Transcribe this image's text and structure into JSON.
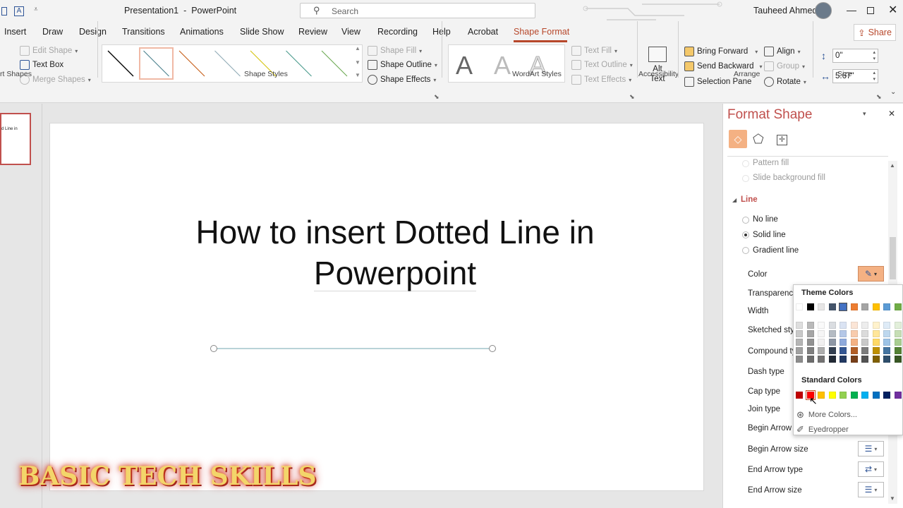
{
  "window": {
    "title": "Presentation1  -  PowerPoint",
    "search_placeholder": "Search",
    "user": "Tauheed Ahmed"
  },
  "tabs": [
    "Insert",
    "Draw",
    "Design",
    "Transitions",
    "Animations",
    "Slide Show",
    "Review",
    "View",
    "Recording",
    "Help",
    "Acrobat",
    "Shape Format"
  ],
  "share_label": "Share",
  "ribbon": {
    "insert_shapes": {
      "label": "rt Shapes",
      "edit_shape": "Edit Shape",
      "text_box": "Text Box",
      "merge_shapes": "Merge Shapes"
    },
    "shape_styles": {
      "label": "Shape Styles",
      "shape_fill": "Shape Fill",
      "shape_outline": "Shape Outline",
      "shape_effects": "Shape Effects"
    },
    "wordart": {
      "label": "WordArt Styles",
      "letter": "A",
      "text_fill": "Text Fill",
      "text_outline": "Text Outline",
      "text_effects": "Text Effects"
    },
    "accessibility": {
      "label": "Accessibility",
      "alt_text_1": "Alt",
      "alt_text_2": "Text"
    },
    "arrange": {
      "label": "Arrange",
      "bring_forward": "Bring Forward",
      "send_backward": "Send Backward",
      "selection_pane": "Selection Pane",
      "align": "Align",
      "group": "Group",
      "rotate": "Rotate"
    },
    "size": {
      "label": "Size",
      "height": "0\"",
      "width": "5.67\""
    }
  },
  "thumbnail_text": "d Line in",
  "slide": {
    "title_line1": "How to insert Dotted Line in",
    "title_line2": "Powerpoint"
  },
  "watermark": "BASIC TECH SKILLS",
  "format_panel": {
    "title": "Format Shape",
    "fill_options": [
      "Pattern fill",
      "Slide background fill"
    ],
    "line_section": "Line",
    "line_options": [
      "No line",
      "Solid line",
      "Gradient line"
    ],
    "props": [
      "Color",
      "Transparency",
      "Width",
      "Sketched styl",
      "Compound ty",
      "Dash type",
      "Cap type",
      "Join type",
      "Begin Arrow t",
      "Begin Arrow size",
      "End Arrow type",
      "End Arrow size"
    ]
  },
  "color_popup": {
    "theme_label": "Theme Colors",
    "standard_label": "Standard Colors",
    "more_colors": "More Colors...",
    "eyedropper": "Eyedropper",
    "theme_top": [
      "#ffffff",
      "#000000",
      "#e7e6e6",
      "#44546a",
      "#4472c4",
      "#ed7d31",
      "#a5a5a5",
      "#ffc000",
      "#5b9bd5",
      "#70ad47"
    ],
    "standard": [
      "#c00000",
      "#ff0000",
      "#ffc000",
      "#ffff00",
      "#92d050",
      "#00b050",
      "#00b0f0",
      "#0070c0",
      "#002060",
      "#7030a0"
    ]
  },
  "line_colors": [
    "#000000",
    "#4a7f8c",
    "#c55a11",
    "#8faab5",
    "#d4c30b",
    "#4a9a8c",
    "#6aa84f"
  ]
}
